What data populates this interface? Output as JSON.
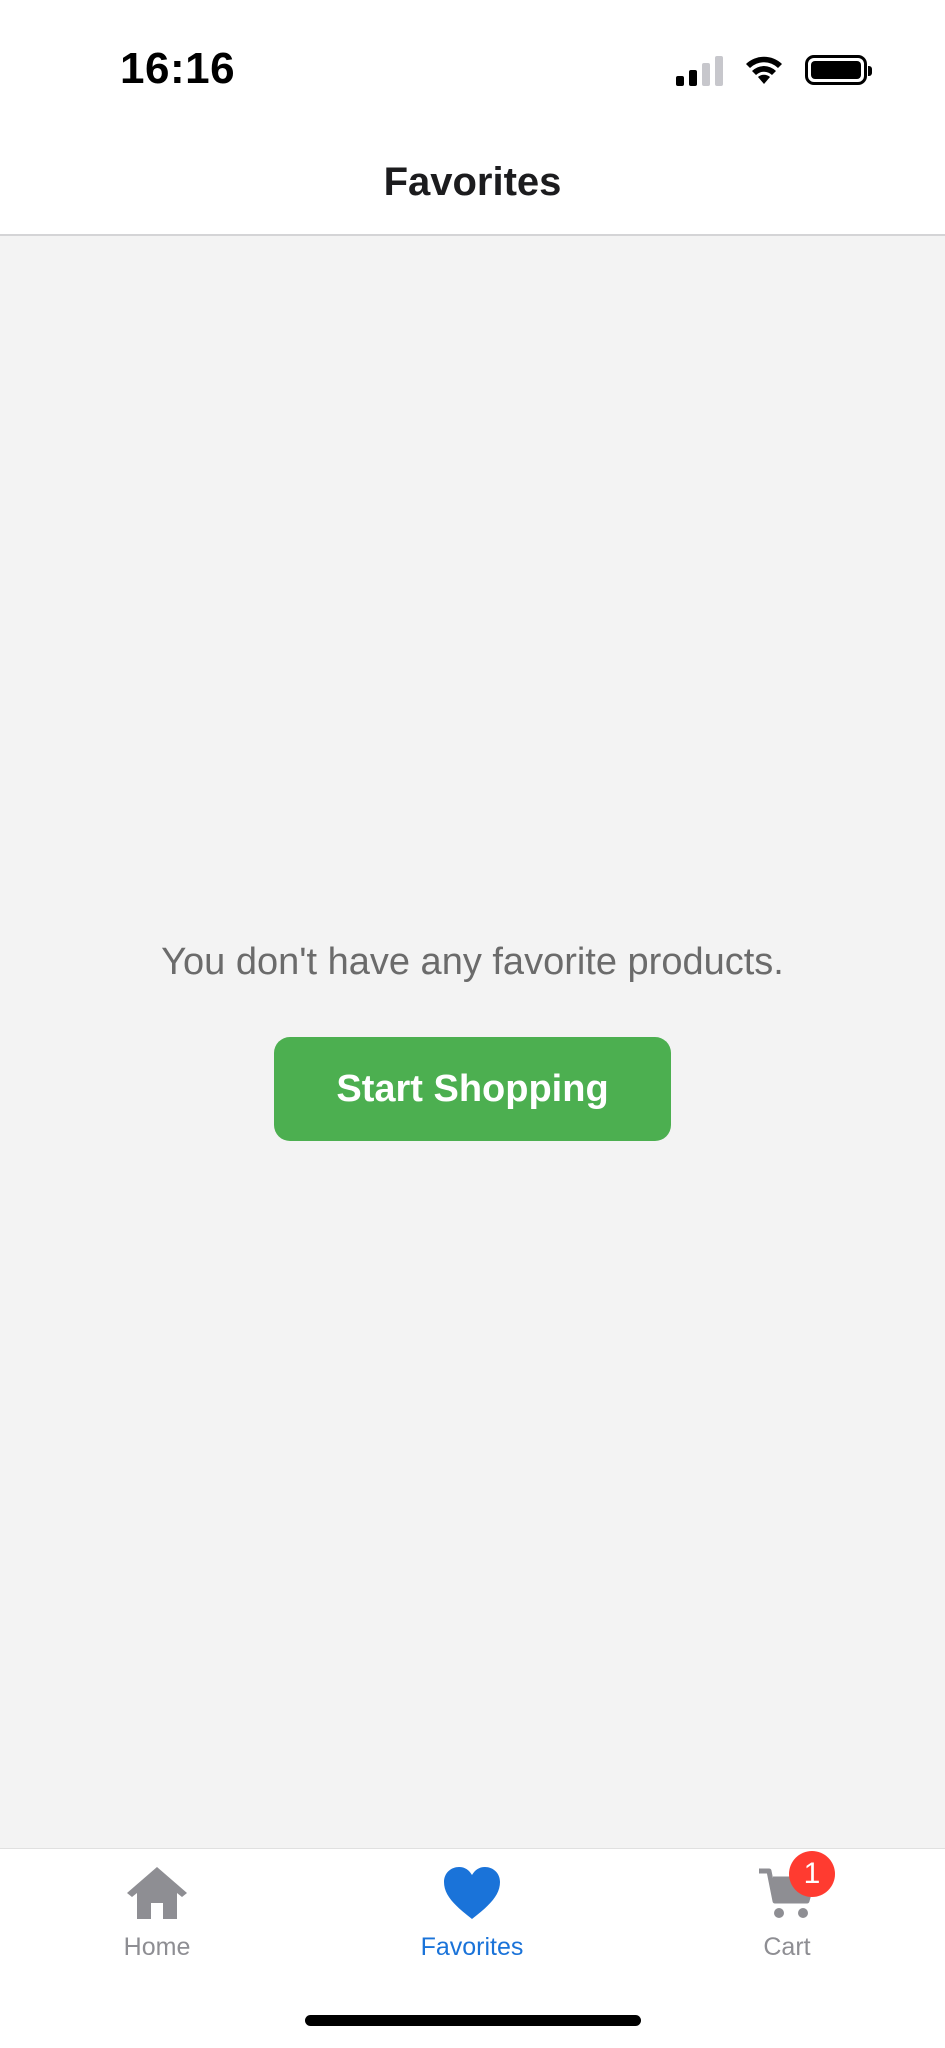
{
  "status_bar": {
    "time": "16:16"
  },
  "header": {
    "title": "Favorites"
  },
  "empty_state": {
    "message": "You don't have any favorite products.",
    "button_label": "Start Shopping"
  },
  "tab_bar": {
    "tabs": [
      {
        "label": "Home",
        "icon": "home-icon",
        "active": false
      },
      {
        "label": "Favorites",
        "icon": "heart-icon",
        "active": true
      },
      {
        "label": "Cart",
        "icon": "cart-icon",
        "active": false,
        "badge": "1"
      }
    ]
  },
  "colors": {
    "accent": "#1a73d9",
    "button": "#4caf50",
    "badge": "#ff3b30",
    "inactive": "#8e8e93",
    "background": "#f3f3f3"
  }
}
